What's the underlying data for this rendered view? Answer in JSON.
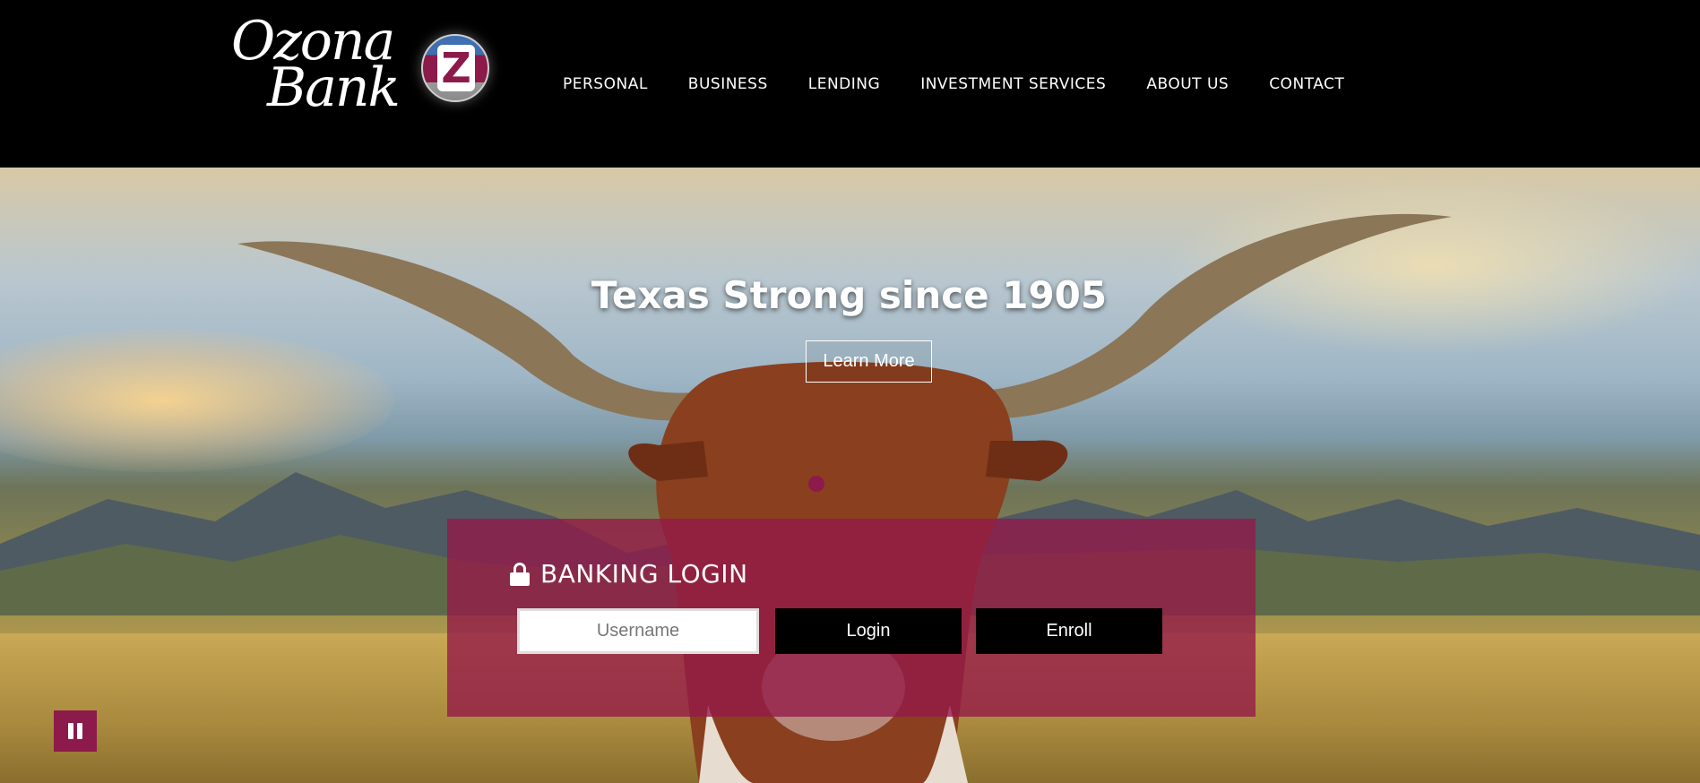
{
  "header": {
    "logo": {
      "line1": "Ozona",
      "line2": "Bank",
      "badge_letter": "Z",
      "icon": "ozona-bank-logo"
    },
    "nav": [
      {
        "label": "PERSONAL"
      },
      {
        "label": "BUSINESS"
      },
      {
        "label": "LENDING"
      },
      {
        "label": "INVESTMENT SERVICES"
      },
      {
        "label": "ABOUT US"
      },
      {
        "label": "CONTACT"
      }
    ]
  },
  "hero": {
    "title": "Texas Strong since 1905",
    "cta_label": "Learn More"
  },
  "login": {
    "title": "BANKING LOGIN",
    "lock_icon": "lock-icon",
    "username_placeholder": "Username",
    "login_label": "Login",
    "enroll_label": "Enroll"
  },
  "slider": {
    "pause_icon": "pause-icon"
  },
  "colors": {
    "brand_maroon": "#8c1a4a",
    "header_bg": "#000000",
    "button_bg": "#000000"
  }
}
